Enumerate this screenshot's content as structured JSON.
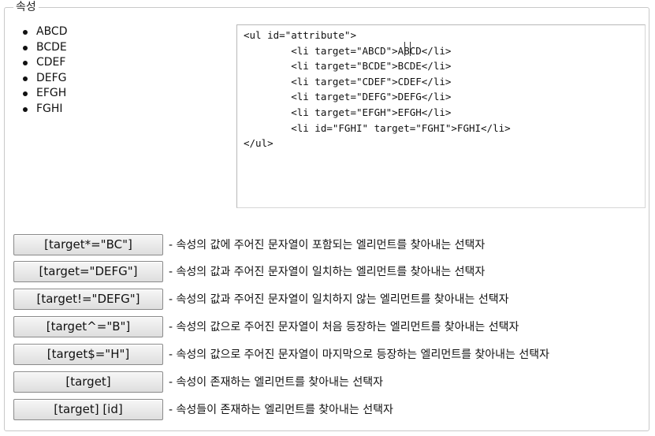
{
  "legend": "속성",
  "list_items": [
    "ABCD",
    "BCDE",
    "CDEF",
    "DEFG",
    "EFGH",
    "FGHI"
  ],
  "code_text": "<ul id=\"attribute\">\n        <li target=\"ABCD\">ABCD</li>\n        <li target=\"BCDE\">BCDE</li>\n        <li target=\"CDEF\">CDEF</li>\n        <li target=\"DEFG\">DEFG</li>\n        <li target=\"EFGH\">EFGH</li>\n        <li id=\"FGHI\" target=\"FGHI\">FGHI</li>\n</ul>",
  "rows": [
    {
      "button": "[target*=\"BC\"]",
      "desc": "- 속성의 값에 주어진 문자열이 포함되는 엘리먼트를 찾아내는 선택자"
    },
    {
      "button": "[target=\"DEFG\"]",
      "desc": "- 속성의 값과 주어진 문자열이 일치하는 엘리먼트를 찾아내는 선택자"
    },
    {
      "button": "[target!=\"DEFG\"]",
      "desc": "- 속성의 값과 주어진 문자열이 일치하지 않는 엘리먼트를 찾아내는 선택자"
    },
    {
      "button": "[target^=\"B\"]",
      "desc": "- 속성의 값으로 주어진 문자열이 처음 등장하는 엘리먼트를 찾아내는 선택자"
    },
    {
      "button": "[target$=\"H\"]",
      "desc": "- 속성의 값으로 주어진 문자열이 마지막으로 등장하는 엘리먼트를 찾아내는 선택자"
    },
    {
      "button": "[target]",
      "desc": "- 속성이 존재하는 엘리먼트를 찾아내는 선택자"
    },
    {
      "button": "[target] [id]",
      "desc": "- 속성들이 존재하는 엘리먼트를 찾아내는 선택자"
    }
  ]
}
